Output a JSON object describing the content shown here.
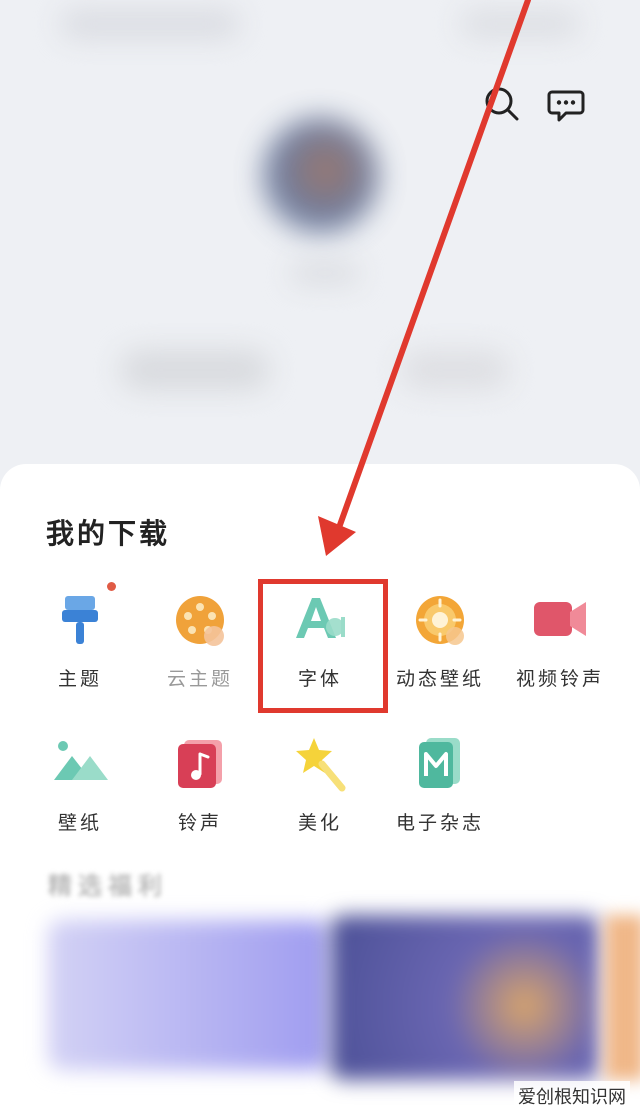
{
  "header": {
    "icons": [
      "search-icon",
      "chat-icon"
    ]
  },
  "downloads": {
    "title": "我的下载",
    "items": [
      {
        "label": "主题",
        "icon": "paint-brush-icon",
        "badge": true
      },
      {
        "label": "云主题",
        "icon": "cloud-theme-reel-icon"
      },
      {
        "label": "字体",
        "icon": "font-aa-icon",
        "highlighted": true
      },
      {
        "label": "动态壁纸",
        "icon": "live-wallpaper-icon"
      },
      {
        "label": "视频铃声",
        "icon": "video-ringtone-icon"
      },
      {
        "label": "壁纸",
        "icon": "mountain-wallpaper-icon"
      },
      {
        "label": "铃声",
        "icon": "music-note-icon"
      },
      {
        "label": "美化",
        "icon": "magic-star-icon"
      },
      {
        "label": "电子杂志",
        "icon": "magazine-m-icon"
      }
    ]
  },
  "section2": {
    "title": "精选福利"
  },
  "colors": {
    "highlight": "#e0392e",
    "badge": "#e05b45"
  },
  "watermark": "爱创根知识网"
}
